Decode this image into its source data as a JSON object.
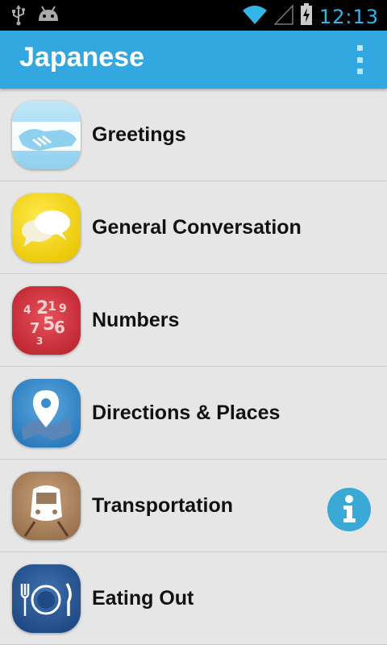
{
  "status_bar": {
    "time": "12:13",
    "icons": [
      "usb-icon",
      "android-debug-icon",
      "wifi-icon",
      "signal-icon",
      "battery-charging-icon"
    ],
    "accent_color": "#33b5e5"
  },
  "action_bar": {
    "title": "Japanese",
    "overflow_icon": "overflow-menu-icon",
    "background_color": "#33a7e0"
  },
  "categories": [
    {
      "label": "Greetings",
      "icon": "handshake-icon"
    },
    {
      "label": "General Conversation",
      "icon": "speech-bubbles-icon"
    },
    {
      "label": "Numbers",
      "icon": "numbers-icon"
    },
    {
      "label": "Directions & Places",
      "icon": "map-pin-icon"
    },
    {
      "label": "Transportation",
      "icon": "train-icon"
    },
    {
      "label": "Eating Out",
      "icon": "plate-cutlery-icon"
    }
  ],
  "info_button": {
    "icon": "info-icon"
  }
}
